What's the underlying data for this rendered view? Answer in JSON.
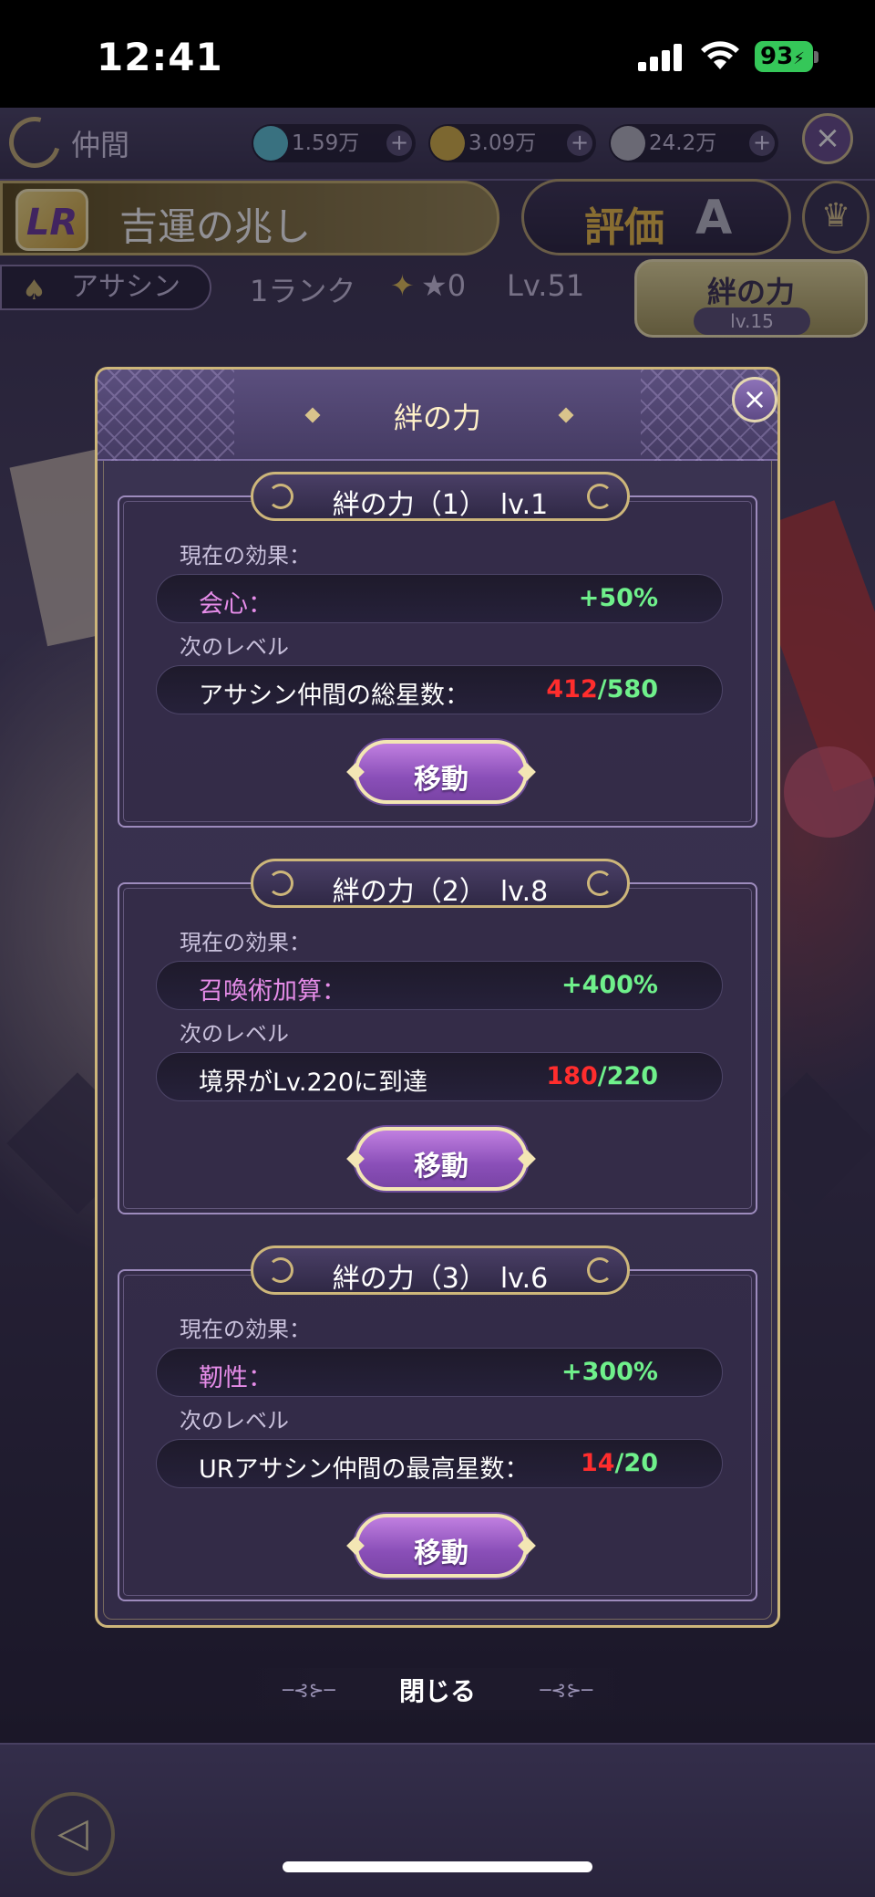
{
  "status_bar": {
    "time": "12:41",
    "battery": "93"
  },
  "top_bar": {
    "title": "仲間",
    "currencies": [
      {
        "icon": "diamond-icon",
        "value": "1.59万",
        "color": "#5fc7d9"
      },
      {
        "icon": "gold-coin-icon",
        "value": "3.09万",
        "color": "#d9b548"
      },
      {
        "icon": "silver-coin-icon",
        "value": "24.2万",
        "color": "#b9b9c4"
      }
    ]
  },
  "character": {
    "rarity": "LR",
    "name": "吉運の兆し",
    "rating_label": "評価",
    "rating_grade": "A",
    "class": "アサシン",
    "rank": "1ランク",
    "stars": "★0",
    "level": "Lv.51"
  },
  "bond_button": {
    "label": "絆の力",
    "level": "lv.15"
  },
  "modal": {
    "title": "絆の力",
    "panels": [
      {
        "tab_title": "絆の力（1）　lv.1",
        "current_label": "現在の効果：",
        "effect_name": "会心：",
        "effect_value": "+50%",
        "next_label": "次のレベル",
        "requirement": "アサシン仲間の総星数：",
        "progress_current": "412",
        "progress_max": "580",
        "button_label": "移動"
      },
      {
        "tab_title": "絆の力（2）　lv.8",
        "current_label": "現在の効果：",
        "effect_name": "召喚術加算：",
        "effect_value": "+400%",
        "next_label": "次のレベル",
        "requirement": "境界がLv.220に到達",
        "progress_current": "180",
        "progress_max": "220",
        "button_label": "移動"
      },
      {
        "tab_title": "絆の力（3）　lv.6",
        "current_label": "現在の効果：",
        "effect_name": "靭性：",
        "effect_value": "+300%",
        "next_label": "次のレベル",
        "requirement": "URアサシン仲間の最高星数：",
        "progress_current": "14",
        "progress_max": "20",
        "button_label": "移動"
      }
    ],
    "close_label": "閉じる"
  }
}
